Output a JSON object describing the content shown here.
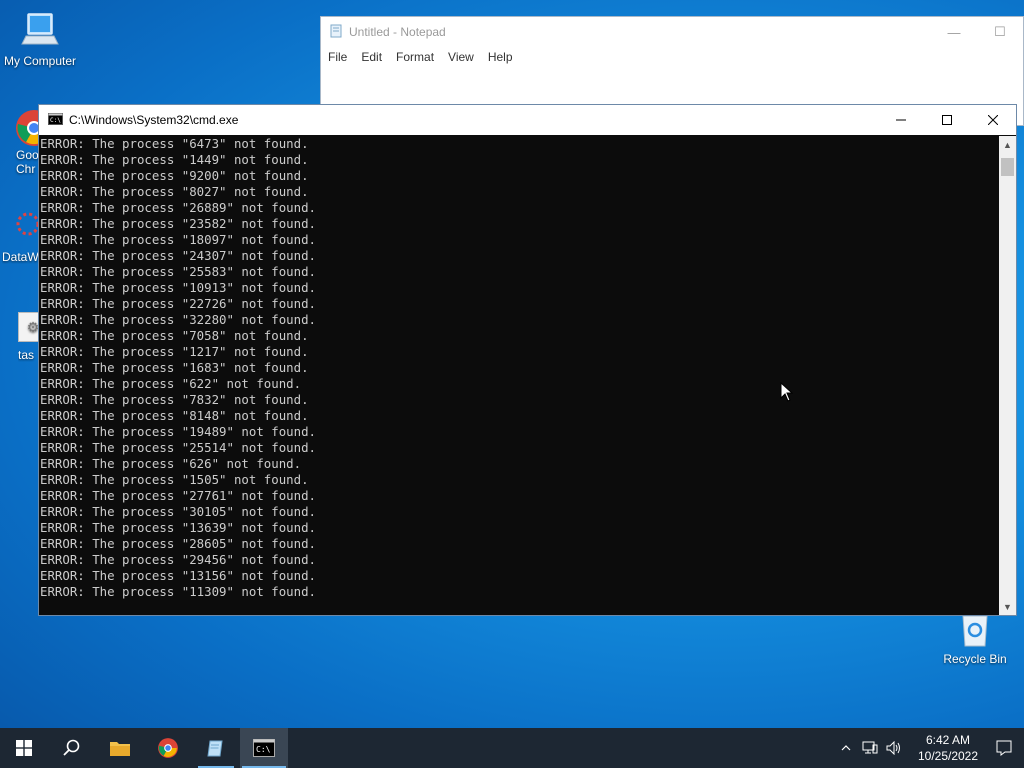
{
  "desktop": {
    "icons": [
      {
        "label": "My Computer",
        "icon": "computer-icon"
      },
      {
        "label": "Goo Chr",
        "icon": "chrome-icon"
      },
      {
        "label": "DataW",
        "icon": "datawrapper-icon"
      },
      {
        "label": "tas",
        "icon": "task-icon"
      },
      {
        "label": "Recycle Bin",
        "icon": "recycle-bin-icon"
      }
    ]
  },
  "notepad": {
    "title": "Untitled - Notepad",
    "menu": [
      "File",
      "Edit",
      "Format",
      "View",
      "Help"
    ]
  },
  "cmd": {
    "title": "C:\\Windows\\System32\\cmd.exe",
    "lines": [
      "ERROR: The process \"6473\" not found.",
      "ERROR: The process \"1449\" not found.",
      "ERROR: The process \"9200\" not found.",
      "ERROR: The process \"8027\" not found.",
      "ERROR: The process \"26889\" not found.",
      "ERROR: The process \"23582\" not found.",
      "ERROR: The process \"18097\" not found.",
      "ERROR: The process \"24307\" not found.",
      "ERROR: The process \"25583\" not found.",
      "ERROR: The process \"10913\" not found.",
      "ERROR: The process \"22726\" not found.",
      "ERROR: The process \"32280\" not found.",
      "ERROR: The process \"7058\" not found.",
      "ERROR: The process \"1217\" not found.",
      "ERROR: The process \"1683\" not found.",
      "ERROR: The process \"622\" not found.",
      "ERROR: The process \"7832\" not found.",
      "ERROR: The process \"8148\" not found.",
      "ERROR: The process \"19489\" not found.",
      "ERROR: The process \"25514\" not found.",
      "ERROR: The process \"626\" not found.",
      "ERROR: The process \"1505\" not found.",
      "ERROR: The process \"27761\" not found.",
      "ERROR: The process \"30105\" not found.",
      "ERROR: The process \"13639\" not found.",
      "ERROR: The process \"28605\" not found.",
      "ERROR: The process \"29456\" not found.",
      "ERROR: The process \"13156\" not found.",
      "ERROR: The process \"11309\" not found."
    ]
  },
  "taskbar": {
    "clock_time": "6:42 AM",
    "clock_date": "10/25/2022",
    "apps": [
      "start-icon",
      "search-icon",
      "file-explorer-icon",
      "chrome-icon",
      "notepad-icon",
      "cmd-icon"
    ]
  },
  "colors": {
    "console_bg": "#0c0c0c",
    "console_text": "#cccccc",
    "taskbar_bg": "#1d2733",
    "accent": "#76b9ed"
  }
}
